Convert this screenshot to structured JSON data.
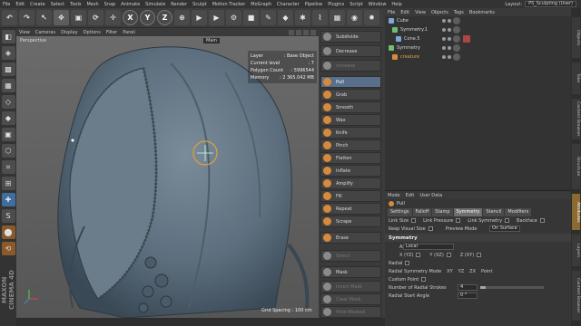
{
  "menu": [
    "File",
    "Edit",
    "Create",
    "Select",
    "Tools",
    "Mesh",
    "Snap",
    "Animate",
    "Simulate",
    "Render",
    "Sculpt",
    "Motion Tracker",
    "MoGraph",
    "Character",
    "Pipeline",
    "Plugins",
    "Script",
    "Window",
    "Help"
  ],
  "layout": {
    "label": "Layout:",
    "value": "PS_Sculpting (User)"
  },
  "toolbar": [
    {
      "name": "undo-icon",
      "glyph": "↶"
    },
    {
      "name": "redo-icon",
      "glyph": "↷"
    },
    {
      "name": "live-select-icon",
      "glyph": "↖"
    },
    {
      "name": "move-icon",
      "glyph": "✥"
    },
    {
      "name": "scale-icon",
      "glyph": "▣"
    },
    {
      "name": "rotate-icon",
      "glyph": "⟳"
    },
    {
      "name": "recent-tool-icon",
      "glyph": "✛"
    },
    {
      "name": "x-axis-lock",
      "glyph": "X"
    },
    {
      "name": "y-axis-lock",
      "glyph": "Y"
    },
    {
      "name": "z-axis-lock",
      "glyph": "Z"
    },
    {
      "name": "coordinate-system-icon",
      "glyph": "⊕"
    },
    {
      "name": "render-view-icon",
      "glyph": "▶"
    },
    {
      "name": "render-picture-viewer-icon",
      "glyph": "▶"
    },
    {
      "name": "render-settings-icon",
      "glyph": "⚙"
    },
    {
      "name": "cube-icon",
      "glyph": "■"
    },
    {
      "name": "pen-icon",
      "glyph": "✎"
    },
    {
      "name": "subdivision-icon",
      "glyph": "◆"
    },
    {
      "name": "array-icon",
      "glyph": "✱"
    },
    {
      "name": "deformer-icon",
      "glyph": "⌇"
    },
    {
      "name": "floor-icon",
      "glyph": "▦"
    },
    {
      "name": "camera-icon",
      "glyph": "◉"
    },
    {
      "name": "light-icon",
      "glyph": "✹"
    }
  ],
  "left_palette": [
    "◧",
    "◈",
    "▩",
    "▦",
    "◇",
    "◆",
    "▣",
    "⬡",
    "⌗",
    "⊞",
    "✚",
    "S",
    "⬤",
    "⟲"
  ],
  "viewport": {
    "menu": [
      "View",
      "Cameras",
      "Display",
      "Options",
      "Filter",
      "Panel"
    ],
    "camera": "Perspective",
    "main_label": "Main",
    "hud": [
      {
        "k": "Layer",
        "v": ": Base Object"
      },
      {
        "k": "Current level",
        "v": ": 7"
      },
      {
        "k": "Polygon Count",
        "v": ": 5996544"
      },
      {
        "k": "Memory",
        "v": ": 2 365.042 MB"
      }
    ],
    "grid_spacing": "Grid Spacing : 100 cm"
  },
  "sculpt_tools": [
    {
      "label": "Subdivide",
      "icon": "gray",
      "dim": false
    },
    {
      "label": "Decrease",
      "icon": "gray",
      "dim": false
    },
    {
      "label": "Increase",
      "icon": "gray",
      "dim": true
    },
    {
      "label": "Pull",
      "icon": "orange",
      "sel": true
    },
    {
      "label": "Grab",
      "icon": "orange"
    },
    {
      "label": "Smooth",
      "icon": "orange"
    },
    {
      "label": "Wax",
      "icon": "orange"
    },
    {
      "label": "Knife",
      "icon": "orange"
    },
    {
      "label": "Pinch",
      "icon": "orange"
    },
    {
      "label": "Flatten",
      "icon": "orange"
    },
    {
      "label": "Inflate",
      "icon": "orange"
    },
    {
      "label": "Amplify",
      "icon": "orange"
    },
    {
      "label": "Fill",
      "icon": "orange"
    },
    {
      "label": "Repeat",
      "icon": "orange"
    },
    {
      "label": "Scrape",
      "icon": "orange"
    },
    {
      "label": "Erase",
      "icon": "orange"
    },
    {
      "label": "Select",
      "icon": "gray",
      "dim": true
    },
    {
      "label": "Mask",
      "icon": "gray"
    },
    {
      "label": "Invert Mask",
      "icon": "gray",
      "dim": true
    },
    {
      "label": "Clear Mask",
      "icon": "gray",
      "dim": true
    },
    {
      "label": "Hide Masked",
      "icon": "gray",
      "dim": true
    }
  ],
  "objects": {
    "menu": [
      "File",
      "Edit",
      "View",
      "Objects",
      "Tags",
      "Bookmarks"
    ],
    "rows": [
      {
        "label": "Cube",
        "icon": "blue",
        "indent": 0
      },
      {
        "label": "Symmetry.1",
        "icon": "gr",
        "indent": 4
      },
      {
        "label": "Cone.5",
        "icon": "blue",
        "indent": 8
      },
      {
        "label": "Symmetry",
        "icon": "gr",
        "indent": 0
      },
      {
        "label": "creature",
        "icon": "or",
        "indent": 4
      }
    ]
  },
  "right_tabs": [
    "Objects",
    "Take",
    "Content Browser",
    "Structure",
    "Attributes",
    "Layers",
    "Content Browser"
  ],
  "attributes": {
    "menu": [
      "Mode",
      "Edit",
      "User Data"
    ],
    "title": "Pull",
    "tabs": [
      "Settings",
      "Falloff",
      "Stamp",
      "Symmetry",
      "Stencil",
      "Modifiers"
    ],
    "active_tab": "Symmetry",
    "row1": [
      "Link Size",
      "Link Pressure",
      "Link Symmetry",
      "Backface"
    ],
    "keep_visual_size": "Keep Visual Size",
    "preview_mode_label": "Preview Mode",
    "preview_mode_value": "On Surface",
    "section": "Symmetry",
    "axis_label": "Axis",
    "axis_value": "Local",
    "axes": [
      "X (YZ)",
      "Y (XZ)",
      "Z (XY)"
    ],
    "radial_label": "Radial",
    "radial_mode_label": "Radial Symmetry Mode",
    "radial_modes": [
      "XY",
      "YZ",
      "ZX",
      "Point"
    ],
    "custom_point": "Custom Point",
    "strokes_label": "Number of Radial Strokes",
    "strokes_value": "4",
    "strokes_fill": 0.08,
    "start_angle_label": "Radial Start Angle",
    "start_angle_value": "0 °"
  }
}
